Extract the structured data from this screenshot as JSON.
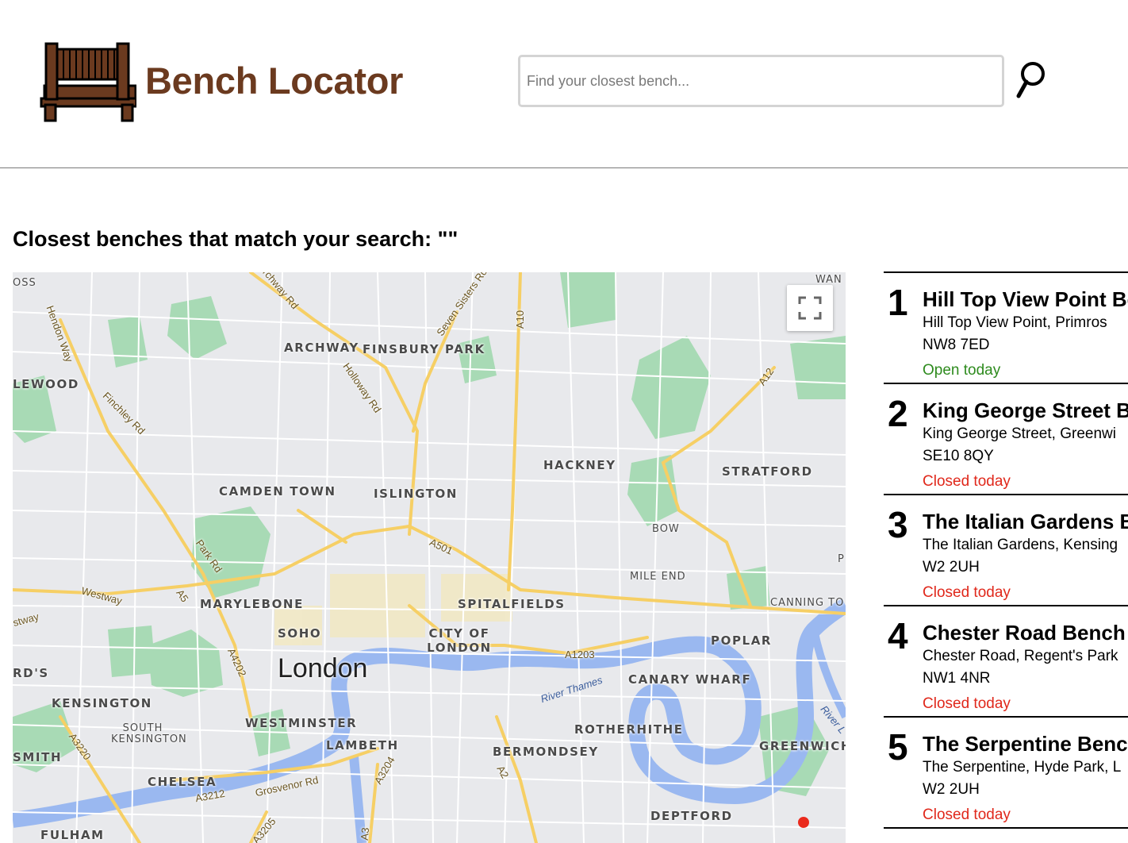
{
  "header": {
    "brand": "Bench Locator",
    "logo_icon": "bench-icon",
    "search_placeholder": "Find your closest bench...",
    "search_value": "",
    "search_icon": "magnifier-icon"
  },
  "results_title": "Closest benches that match your search: \"\"",
  "map": {
    "city_label": "London",
    "area_labels": [
      "ARCHWAY",
      "FINSBURY PARK",
      "HACKNEY",
      "STRATFORD",
      "CAMDEN TOWN",
      "ISLINGTON",
      "BOW",
      "MILE END",
      "MARYLEBONE",
      "SPITALFIELDS",
      "SOHO",
      "CITY OF LONDON",
      "POPLAR",
      "CANARY WHARF",
      "KENSINGTON",
      "SOUTH KENSINGTON",
      "WESTMINSTER",
      "LAMBETH",
      "ROTHERHITHE",
      "BERMONDSEY",
      "GREENWICH",
      "CHELSEA",
      "DEPTFORD",
      "FULHAM",
      "LEWOOD",
      "CANNING TO",
      "WAN",
      "OSS",
      "RD'S",
      "SMITH",
      "P"
    ],
    "road_labels": [
      "Archway Rd",
      "Seven Sisters Rd",
      "A10",
      "Hendon Way",
      "Holloway Rd",
      "Finchley Rd",
      "A12",
      "A501",
      "Park Rd",
      "Westway",
      "A5",
      "A4202",
      "A1203",
      "A3220",
      "A3212",
      "Grosvenor Rd",
      "A3204",
      "A2",
      "A3205",
      "A3",
      "stway"
    ],
    "water_labels": [
      "River Thames",
      "River L"
    ],
    "fullscreen_icon": "fullscreen-icon",
    "marker_icon": "location-marker"
  },
  "results": [
    {
      "rank": "1",
      "name": "Hill Top View Point Be",
      "address": "Hill Top View Point, Primros",
      "postcode": "NW8 7ED",
      "status": "Open today",
      "open": true
    },
    {
      "rank": "2",
      "name": "King George Street Be",
      "address": "King George Street, Greenwi",
      "postcode": "SE10 8QY",
      "status": "Closed today",
      "open": false
    },
    {
      "rank": "3",
      "name": "The Italian Gardens B",
      "address": "The Italian Gardens, Kensing",
      "postcode": "W2 2UH",
      "status": "Closed today",
      "open": false
    },
    {
      "rank": "4",
      "name": "Chester Road Bench",
      "address": "Chester Road, Regent's Park",
      "postcode": "NW1 4NR",
      "status": "Closed today",
      "open": false
    },
    {
      "rank": "5",
      "name": "The Serpentine Bench",
      "address": "The Serpentine, Hyde Park, L",
      "postcode": "W2 2UH",
      "status": "Closed today",
      "open": false
    }
  ],
  "colors": {
    "brand": "#6b3a1f",
    "open": "#2e8b1e",
    "closed": "#e0281b",
    "park": "#a8dab5",
    "water": "#9ab8f0",
    "major_road": "#f6cf65"
  }
}
